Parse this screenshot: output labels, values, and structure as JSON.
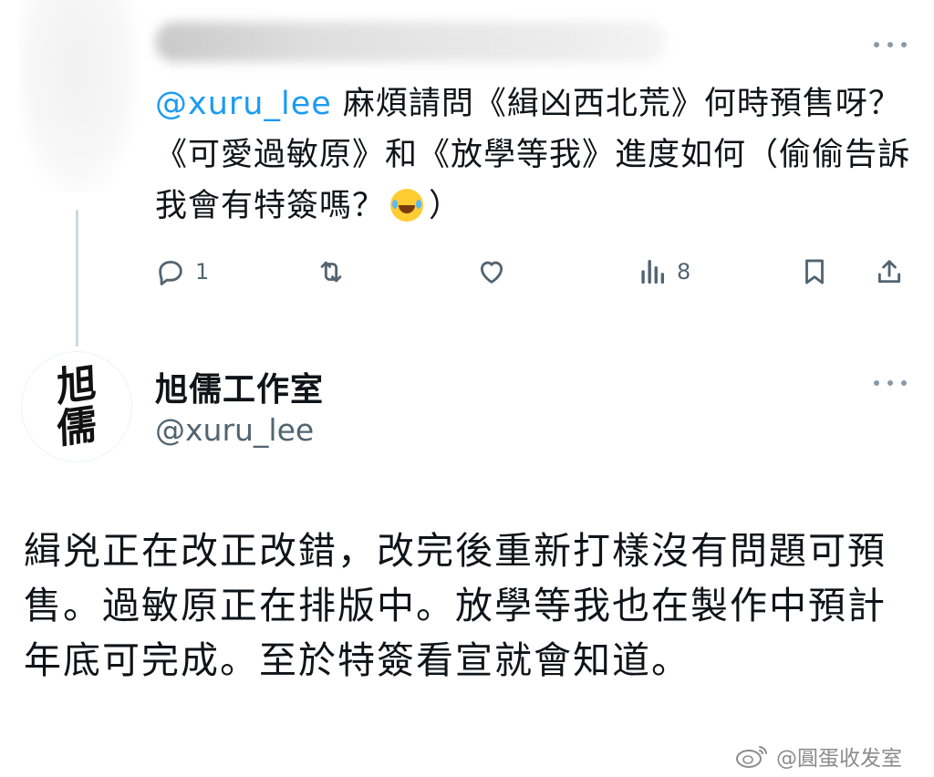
{
  "reply_tweet": {
    "mention": "@xuru_lee",
    "text_part1": " 麻煩請問《緝凶西北荒》何時預售呀？《可愛過敏原》和《放學等我》進度如何（偷偷告訴我會有特簽嗎？",
    "text_part2": "）",
    "emoji": "face-with-tears-of-joy",
    "actions": {
      "reply_count": "1",
      "views_count": "8"
    }
  },
  "main_tweet": {
    "avatar_text": [
      "旭",
      "儒"
    ],
    "display_name": "旭儒工作室",
    "handle": "@xuru_lee",
    "body": "緝兇正在改正改錯，改完後重新打樣沒有問題可預售。過敏原正在排版中。放學等我也在製作中預計年底可完成。至於特簽看宣就會知道。"
  },
  "watermark": {
    "text": "@圓蛋收发室"
  },
  "icons": {
    "reply": "comment-icon",
    "retweet": "retweet-icon",
    "like": "heart-icon",
    "views": "views-chart-icon",
    "bookmark": "bookmark-icon",
    "share": "share-icon",
    "more": "more-dots-icon"
  },
  "colors": {
    "accent": "#1d9bf0",
    "text": "#0f1419",
    "muted": "#536471"
  }
}
